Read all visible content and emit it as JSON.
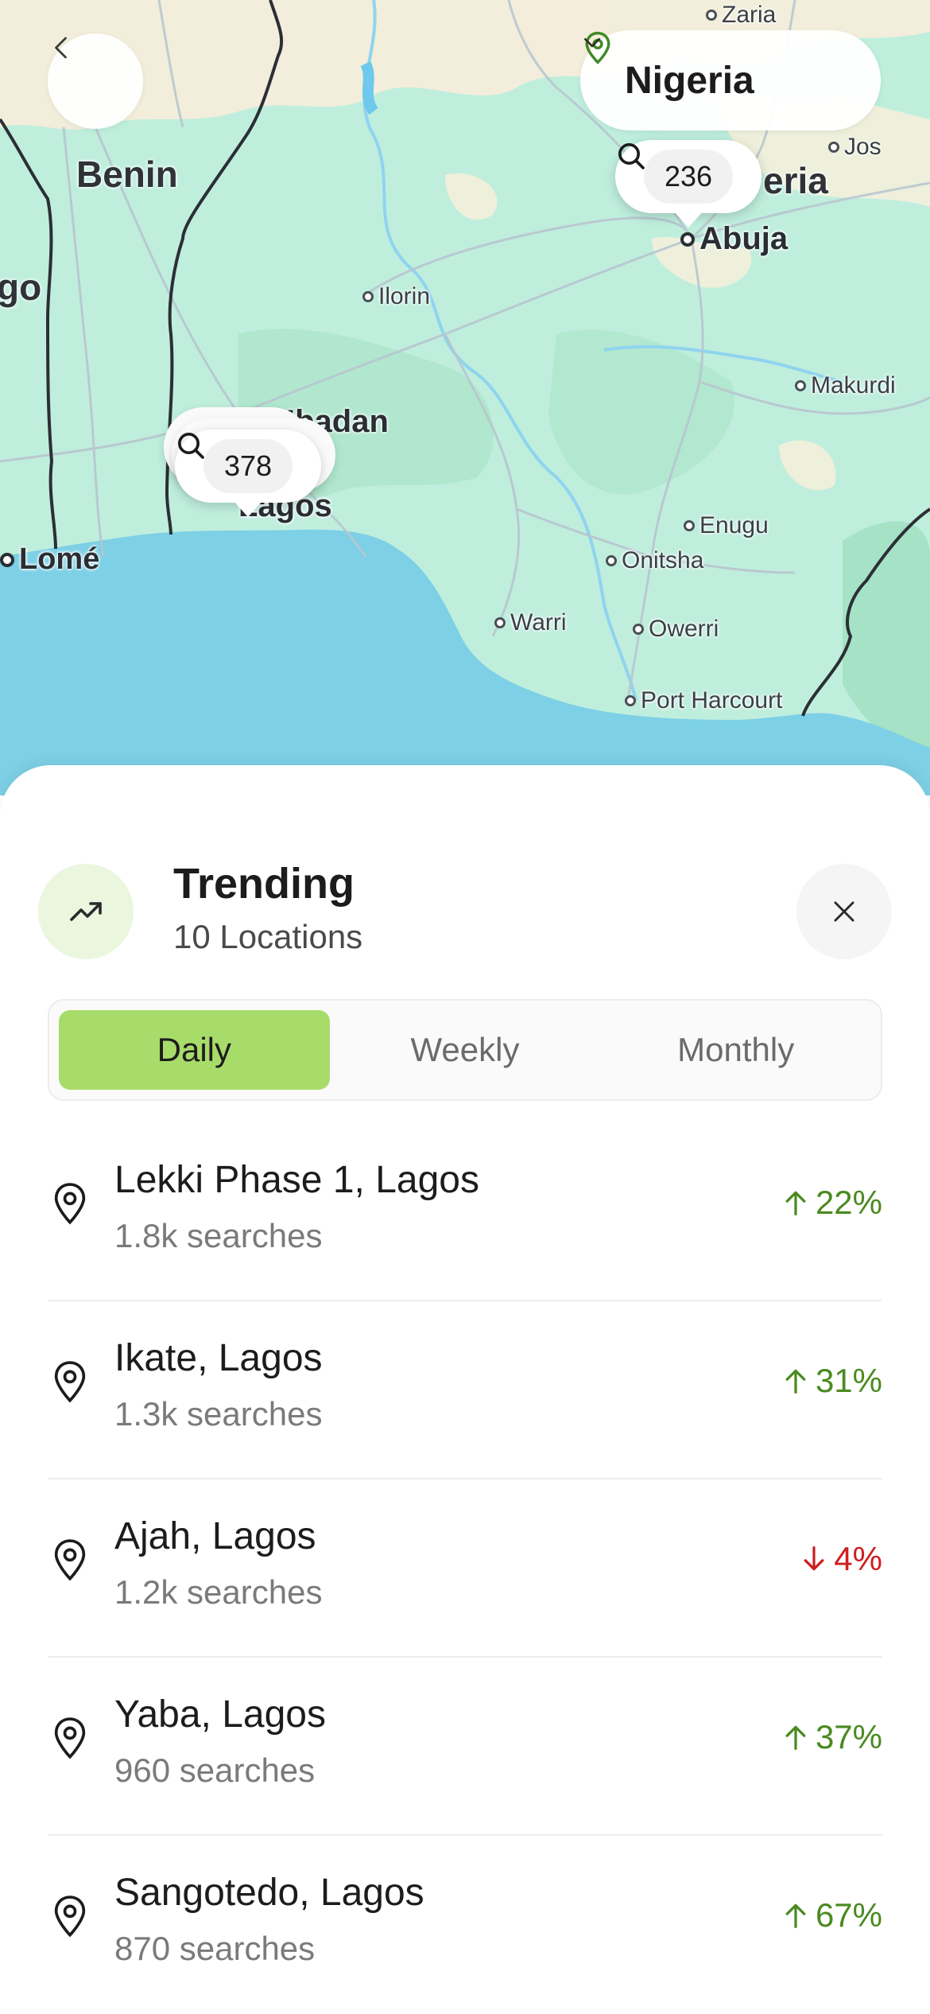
{
  "map": {
    "country_labels": [
      "Benin",
      "go"
    ],
    "cities": {
      "zaria": "Zaria",
      "jos": "Jos",
      "abuja": "Abuja",
      "ilorin": "Ilorin",
      "makurdi": "Makurdi",
      "ibadan": "Ibadan",
      "lagos": "Lagos",
      "lome": "Lomé",
      "enugu": "Enugu",
      "onitsha": "Onitsha",
      "warri": "Warri",
      "owerri": "Owerri",
      "port_harcourt": "Port Harcourt",
      "nigeria_partial": "eria"
    },
    "markers": [
      {
        "count": "236",
        "icon": "search-icon"
      },
      {
        "count": "378",
        "icon": "search-icon"
      }
    ]
  },
  "header": {
    "back_icon": "chevron-left-icon",
    "country_selector": {
      "label": "Nigeria",
      "icon": "location-pin-icon",
      "chevron": "chevron-down-icon"
    }
  },
  "sheet": {
    "title": "Trending",
    "subtitle": "10 Locations",
    "tabs": [
      {
        "label": "Daily",
        "active": true
      },
      {
        "label": "Weekly",
        "active": false
      },
      {
        "label": "Monthly",
        "active": false
      }
    ],
    "locations": [
      {
        "name": "Lekki Phase 1, Lagos",
        "searches": "1.8k searches",
        "change": "22%",
        "direction": "up"
      },
      {
        "name": "Ikate, Lagos",
        "searches": "1.3k searches",
        "change": "31%",
        "direction": "up"
      },
      {
        "name": "Ajah, Lagos",
        "searches": "1.2k searches",
        "change": "4%",
        "direction": "down"
      },
      {
        "name": "Yaba, Lagos",
        "searches": "960 searches",
        "change": "37%",
        "direction": "up"
      },
      {
        "name": "Sangotedo, Lagos",
        "searches": "870 searches",
        "change": "67%",
        "direction": "up"
      }
    ]
  },
  "colors": {
    "accent_green": "#a8dc6a",
    "positive": "#4a8a20",
    "negative": "#cc1f1f",
    "sea": "#7dd0e6",
    "land": "#c8eedd"
  }
}
